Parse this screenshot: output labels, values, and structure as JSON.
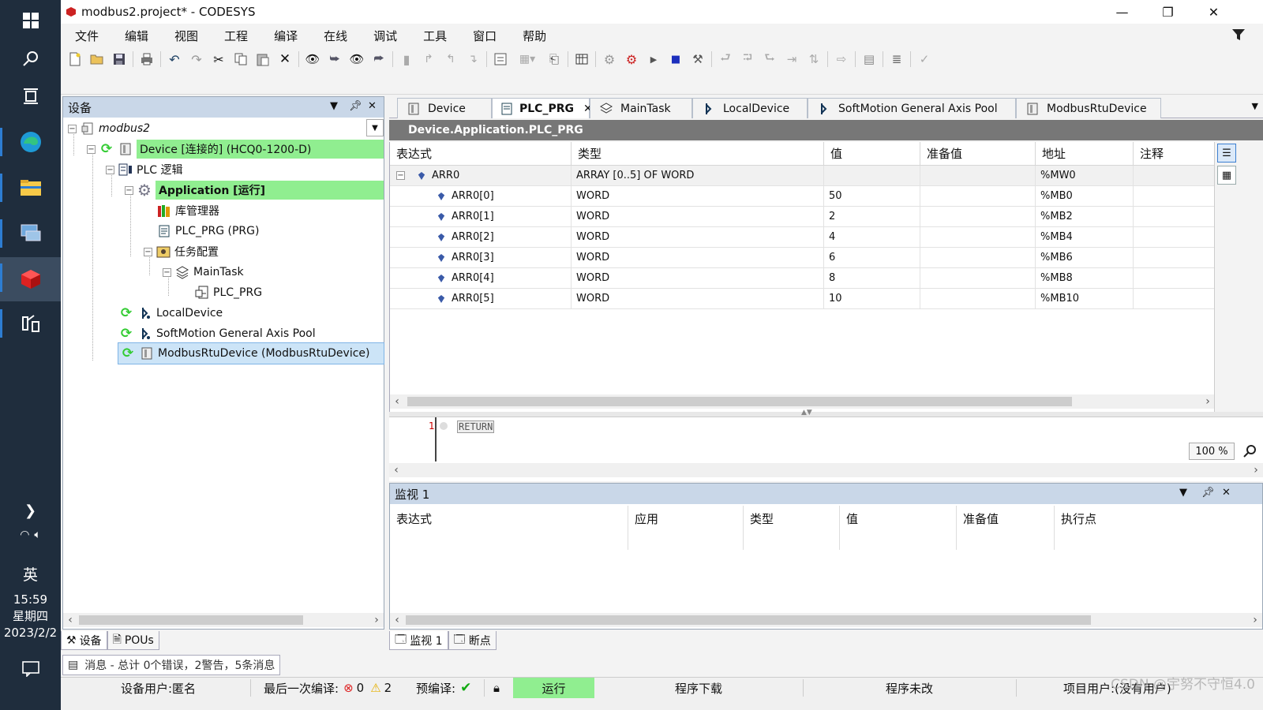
{
  "window": {
    "title": "modbus2.project* - CODESYS",
    "minimize": "—",
    "restore": "❐",
    "close": "✕"
  },
  "menu": [
    "文件",
    "编辑",
    "视图",
    "工程",
    "编译",
    "在线",
    "调试",
    "工具",
    "窗口",
    "帮助"
  ],
  "taskbar": {
    "time": "15:59",
    "weekday": "星期四",
    "date": "2023/2/2",
    "ime": "英"
  },
  "devices_panel": {
    "title": "设备",
    "tree": [
      {
        "label": "modbus2",
        "icon": "project-icon",
        "level": 0
      },
      {
        "label": "Device [连接的] (HCQ0-1200-D)",
        "icon": "device-icon",
        "level": 1,
        "highlight": "green"
      },
      {
        "label": "PLC 逻辑",
        "icon": "plc-logic-icon",
        "level": 2
      },
      {
        "label": "Application [运行]",
        "icon": "application-gear-icon",
        "level": 3,
        "highlight": "green"
      },
      {
        "label": "库管理器",
        "icon": "library-manager-icon",
        "level": 4
      },
      {
        "label": "PLC_PRG (PRG)",
        "icon": "pou-icon",
        "level": 4
      },
      {
        "label": "任务配置",
        "icon": "task-config-icon",
        "level": 4
      },
      {
        "label": "MainTask",
        "icon": "task-icon",
        "level": 5
      },
      {
        "label": "PLC_PRG",
        "icon": "program-call-icon",
        "level": 6
      },
      {
        "label": "LocalDevice",
        "icon": "axis-icon",
        "level": 2
      },
      {
        "label": "SoftMotion General Axis Pool",
        "icon": "axis-icon",
        "level": 2
      },
      {
        "label": "ModbusRtuDevice (ModbusRtuDevice)",
        "icon": "device-icon",
        "level": 2,
        "highlight": "blue"
      }
    ],
    "bottom_tabs": [
      "设备",
      "POUs"
    ],
    "messages": "消息 - 总计 0个错误，2警告，5条消息"
  },
  "editor": {
    "tabs": [
      "Device",
      "PLC_PRG",
      "MainTask",
      "LocalDevice",
      "SoftMotion General Axis Pool",
      "ModbusRtuDevice"
    ],
    "active_tab": "PLC_PRG",
    "path": "Device.Application.PLC_PRG",
    "columns": [
      "表达式",
      "类型",
      "值",
      "准备值",
      "地址",
      "注释"
    ],
    "rows": [
      {
        "expr": "ARR0",
        "type": "ARRAY [0..5] OF WORD",
        "value": "",
        "prepared": "",
        "address": "%MW0",
        "comment": "",
        "parent": true
      },
      {
        "expr": "ARR0[0]",
        "type": "WORD",
        "value": "50",
        "prepared": "",
        "address": "%MB0",
        "comment": ""
      },
      {
        "expr": "ARR0[1]",
        "type": "WORD",
        "value": "2",
        "prepared": "",
        "address": "%MB2",
        "comment": ""
      },
      {
        "expr": "ARR0[2]",
        "type": "WORD",
        "value": "4",
        "prepared": "",
        "address": "%MB4",
        "comment": ""
      },
      {
        "expr": "ARR0[3]",
        "type": "WORD",
        "value": "6",
        "prepared": "",
        "address": "%MB6",
        "comment": ""
      },
      {
        "expr": "ARR0[4]",
        "type": "WORD",
        "value": "8",
        "prepared": "",
        "address": "%MB8",
        "comment": ""
      },
      {
        "expr": "ARR0[5]",
        "type": "WORD",
        "value": "10",
        "prepared": "",
        "address": "%MB10",
        "comment": ""
      }
    ],
    "code_line_number": "1",
    "code_text": "RETURN",
    "zoom": "100 %"
  },
  "watch_panel": {
    "title": "监视 1",
    "columns": [
      "表达式",
      "应用",
      "类型",
      "值",
      "准备值",
      "执行点"
    ],
    "bottom_tabs": [
      "监视 1",
      "断点"
    ]
  },
  "statusbar": {
    "device_user": "设备用户:匿名",
    "last_build_label": "最后一次编译:",
    "errors": "0",
    "warnings": "2",
    "precompile": "预编译:",
    "run_state": "运行",
    "download": "程序下载",
    "unchanged": "程序未改",
    "project_user": "项目用户:(没有用户)",
    "watermark": "CSDN @宇努不守恒4.0"
  },
  "colors": {
    "highlight_green": "#90ee90",
    "highlight_blue": "#cce4f7",
    "panel_header": "#c9d7e8",
    "path_bar": "#777777"
  }
}
